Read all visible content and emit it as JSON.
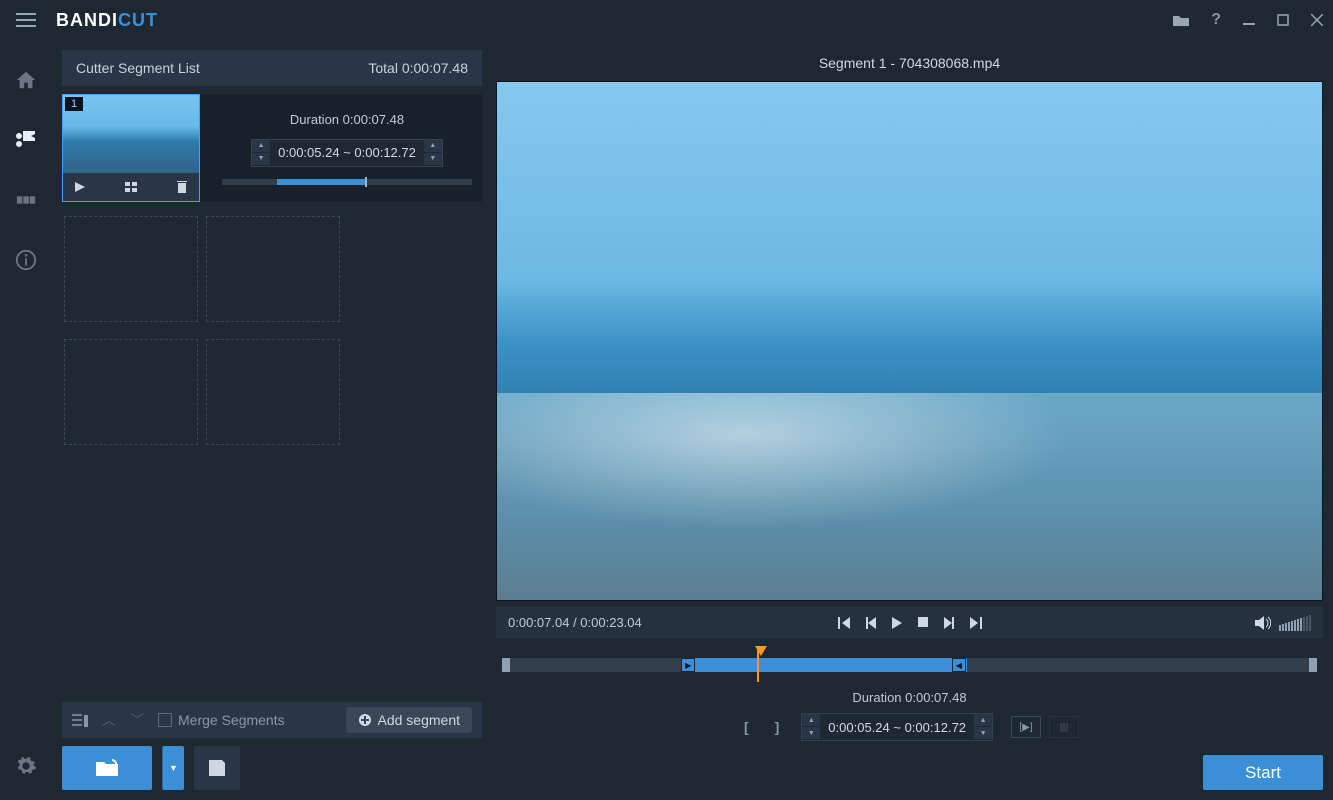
{
  "app": {
    "logo_a": "BANDI",
    "logo_b": "CUT"
  },
  "titlebar_icons": [
    "folder",
    "help",
    "min",
    "max",
    "close"
  ],
  "rail": {
    "items": [
      "home",
      "cut",
      "join",
      "info"
    ],
    "bottom": "settings"
  },
  "segment_panel": {
    "title": "Cutter Segment List",
    "total_label": "Total 0:00:07.48",
    "segment": {
      "index": "1",
      "duration_label": "Duration  0:00:07.48",
      "start_time": "0:00:05.24",
      "sep": " ~ ",
      "end_time": "0:00:12.72"
    },
    "merge_label": "Merge Segments",
    "add_label": "Add segment"
  },
  "preview": {
    "title": "Segment 1 - 704308068.mp4",
    "current_time": "0:00:07.04",
    "total_time": "0:00:23.04",
    "time_sep": " / ",
    "duration_label": "Duration  0:00:07.48",
    "start_time": "0:00:05.24",
    "sep": " ~ ",
    "end_time": "0:00:12.72"
  },
  "start_button": "Start"
}
